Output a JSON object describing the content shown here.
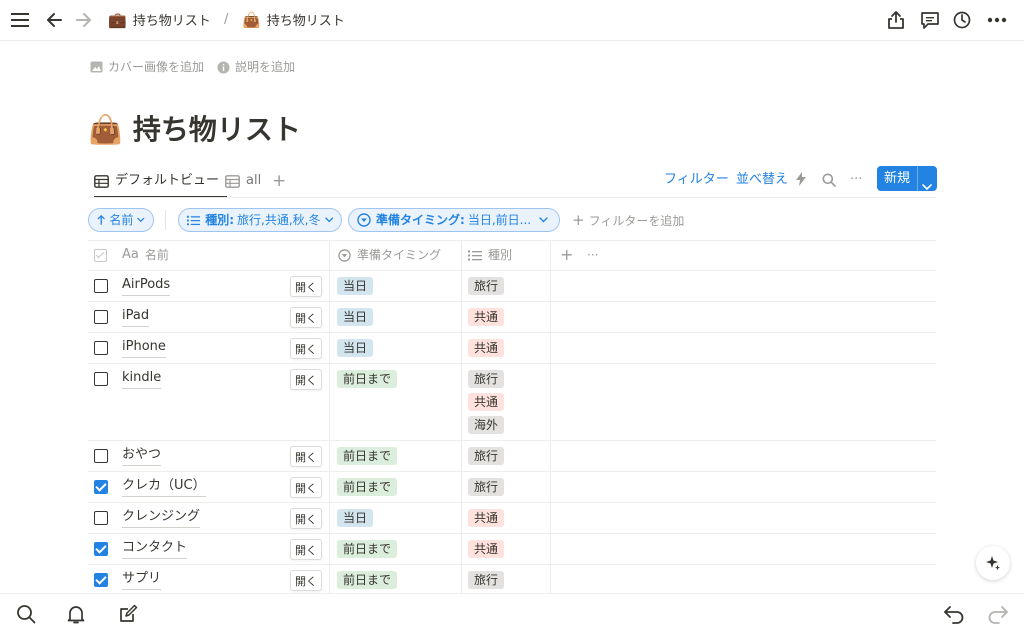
{
  "breadcrumb": {
    "parent": {
      "emoji": "💼",
      "label": "持ち物リスト"
    },
    "separator": "/",
    "current": {
      "emoji": "👜",
      "label": "持ち物リスト"
    }
  },
  "page": {
    "add_cover": "カバー画像を追加",
    "add_description": "説明を追加",
    "title_emoji": "👜",
    "title": "持ち物リスト"
  },
  "views": {
    "tabs": [
      {
        "label": "デフォルトビュー",
        "active": true
      },
      {
        "label": "all",
        "active": false
      }
    ],
    "add": "+"
  },
  "toolbar": {
    "filter": "フィルター",
    "sort": "並べ替え",
    "more": "···",
    "new": "新規"
  },
  "filters": {
    "sort_chip": "名前",
    "type_chip_key": "種別:",
    "type_chip_value": "旅行,共通,秋,冬",
    "timing_chip_key": "準備タイミング:",
    "timing_chip_value": "当日,前日...",
    "add_filter": "フィルターを追加"
  },
  "columns": {
    "name_prefix": "Aa",
    "name": "名前",
    "timing": "準備タイミング",
    "type": "種別",
    "add": "+",
    "more": "···"
  },
  "open_label": "開く",
  "rows": [
    {
      "name": "AirPods",
      "checked": false,
      "timing": "当日",
      "types": [
        "旅行"
      ]
    },
    {
      "name": "iPad",
      "checked": false,
      "timing": "当日",
      "types": [
        "共通"
      ]
    },
    {
      "name": "iPhone",
      "checked": false,
      "timing": "当日",
      "types": [
        "共通"
      ]
    },
    {
      "name": "kindle",
      "checked": false,
      "timing": "前日まで",
      "types": [
        "旅行",
        "共通",
        "海外"
      ]
    },
    {
      "name": "おやつ",
      "checked": false,
      "timing": "前日まで",
      "types": [
        "旅行"
      ]
    },
    {
      "name": "クレカ（UC）",
      "checked": true,
      "timing": "前日まで",
      "types": [
        "旅行"
      ]
    },
    {
      "name": "クレンジング",
      "checked": false,
      "timing": "当日",
      "types": [
        "共通"
      ]
    },
    {
      "name": "コンタクト",
      "checked": true,
      "timing": "前日まで",
      "types": [
        "共通"
      ]
    },
    {
      "name": "サプリ",
      "checked": true,
      "timing": "前日まで",
      "types": [
        "旅行"
      ]
    }
  ],
  "colors": {
    "accent": "#2383e2",
    "tag_blue": "#d3e5ef",
    "tag_green": "#dbeddb",
    "tag_gray": "#e3e2e0",
    "tag_red": "#ffe2dd"
  }
}
